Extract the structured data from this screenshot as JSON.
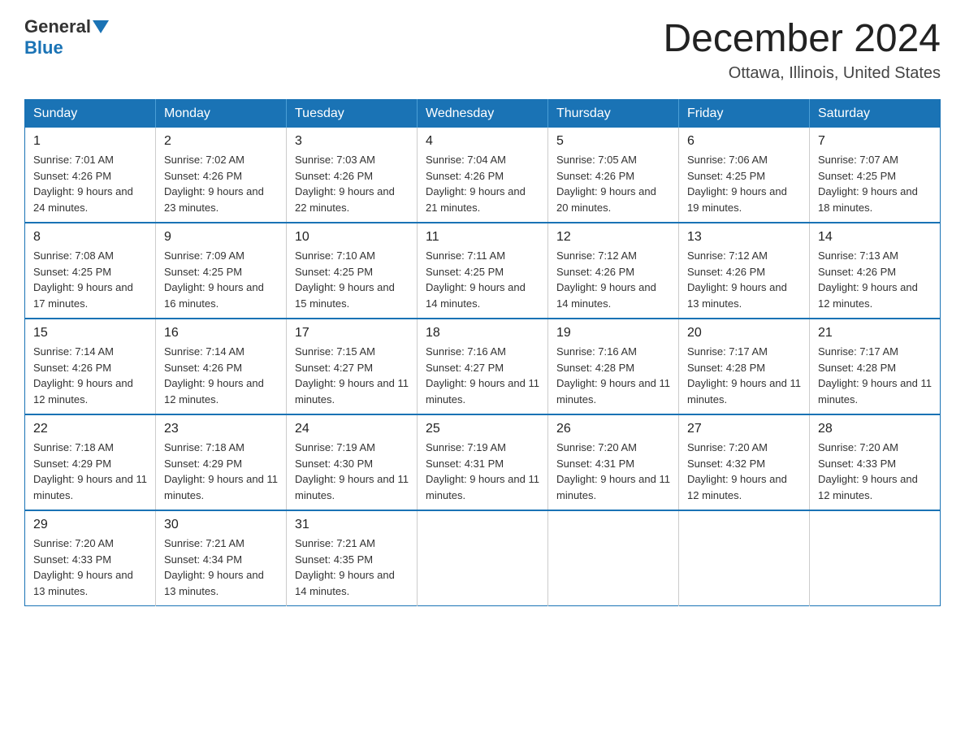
{
  "header": {
    "logo_general": "General",
    "logo_blue": "Blue",
    "title": "December 2024",
    "location": "Ottawa, Illinois, United States"
  },
  "weekdays": [
    "Sunday",
    "Monday",
    "Tuesday",
    "Wednesday",
    "Thursday",
    "Friday",
    "Saturday"
  ],
  "weeks": [
    [
      {
        "day": "1",
        "sunrise": "7:01 AM",
        "sunset": "4:26 PM",
        "daylight": "9 hours and 24 minutes."
      },
      {
        "day": "2",
        "sunrise": "7:02 AM",
        "sunset": "4:26 PM",
        "daylight": "9 hours and 23 minutes."
      },
      {
        "day": "3",
        "sunrise": "7:03 AM",
        "sunset": "4:26 PM",
        "daylight": "9 hours and 22 minutes."
      },
      {
        "day": "4",
        "sunrise": "7:04 AM",
        "sunset": "4:26 PM",
        "daylight": "9 hours and 21 minutes."
      },
      {
        "day": "5",
        "sunrise": "7:05 AM",
        "sunset": "4:26 PM",
        "daylight": "9 hours and 20 minutes."
      },
      {
        "day": "6",
        "sunrise": "7:06 AM",
        "sunset": "4:25 PM",
        "daylight": "9 hours and 19 minutes."
      },
      {
        "day": "7",
        "sunrise": "7:07 AM",
        "sunset": "4:25 PM",
        "daylight": "9 hours and 18 minutes."
      }
    ],
    [
      {
        "day": "8",
        "sunrise": "7:08 AM",
        "sunset": "4:25 PM",
        "daylight": "9 hours and 17 minutes."
      },
      {
        "day": "9",
        "sunrise": "7:09 AM",
        "sunset": "4:25 PM",
        "daylight": "9 hours and 16 minutes."
      },
      {
        "day": "10",
        "sunrise": "7:10 AM",
        "sunset": "4:25 PM",
        "daylight": "9 hours and 15 minutes."
      },
      {
        "day": "11",
        "sunrise": "7:11 AM",
        "sunset": "4:25 PM",
        "daylight": "9 hours and 14 minutes."
      },
      {
        "day": "12",
        "sunrise": "7:12 AM",
        "sunset": "4:26 PM",
        "daylight": "9 hours and 14 minutes."
      },
      {
        "day": "13",
        "sunrise": "7:12 AM",
        "sunset": "4:26 PM",
        "daylight": "9 hours and 13 minutes."
      },
      {
        "day": "14",
        "sunrise": "7:13 AM",
        "sunset": "4:26 PM",
        "daylight": "9 hours and 12 minutes."
      }
    ],
    [
      {
        "day": "15",
        "sunrise": "7:14 AM",
        "sunset": "4:26 PM",
        "daylight": "9 hours and 12 minutes."
      },
      {
        "day": "16",
        "sunrise": "7:14 AM",
        "sunset": "4:26 PM",
        "daylight": "9 hours and 12 minutes."
      },
      {
        "day": "17",
        "sunrise": "7:15 AM",
        "sunset": "4:27 PM",
        "daylight": "9 hours and 11 minutes."
      },
      {
        "day": "18",
        "sunrise": "7:16 AM",
        "sunset": "4:27 PM",
        "daylight": "9 hours and 11 minutes."
      },
      {
        "day": "19",
        "sunrise": "7:16 AM",
        "sunset": "4:28 PM",
        "daylight": "9 hours and 11 minutes."
      },
      {
        "day": "20",
        "sunrise": "7:17 AM",
        "sunset": "4:28 PM",
        "daylight": "9 hours and 11 minutes."
      },
      {
        "day": "21",
        "sunrise": "7:17 AM",
        "sunset": "4:28 PM",
        "daylight": "9 hours and 11 minutes."
      }
    ],
    [
      {
        "day": "22",
        "sunrise": "7:18 AM",
        "sunset": "4:29 PM",
        "daylight": "9 hours and 11 minutes."
      },
      {
        "day": "23",
        "sunrise": "7:18 AM",
        "sunset": "4:29 PM",
        "daylight": "9 hours and 11 minutes."
      },
      {
        "day": "24",
        "sunrise": "7:19 AM",
        "sunset": "4:30 PM",
        "daylight": "9 hours and 11 minutes."
      },
      {
        "day": "25",
        "sunrise": "7:19 AM",
        "sunset": "4:31 PM",
        "daylight": "9 hours and 11 minutes."
      },
      {
        "day": "26",
        "sunrise": "7:20 AM",
        "sunset": "4:31 PM",
        "daylight": "9 hours and 11 minutes."
      },
      {
        "day": "27",
        "sunrise": "7:20 AM",
        "sunset": "4:32 PM",
        "daylight": "9 hours and 12 minutes."
      },
      {
        "day": "28",
        "sunrise": "7:20 AM",
        "sunset": "4:33 PM",
        "daylight": "9 hours and 12 minutes."
      }
    ],
    [
      {
        "day": "29",
        "sunrise": "7:20 AM",
        "sunset": "4:33 PM",
        "daylight": "9 hours and 13 minutes."
      },
      {
        "day": "30",
        "sunrise": "7:21 AM",
        "sunset": "4:34 PM",
        "daylight": "9 hours and 13 minutes."
      },
      {
        "day": "31",
        "sunrise": "7:21 AM",
        "sunset": "4:35 PM",
        "daylight": "9 hours and 14 minutes."
      },
      null,
      null,
      null,
      null
    ]
  ]
}
